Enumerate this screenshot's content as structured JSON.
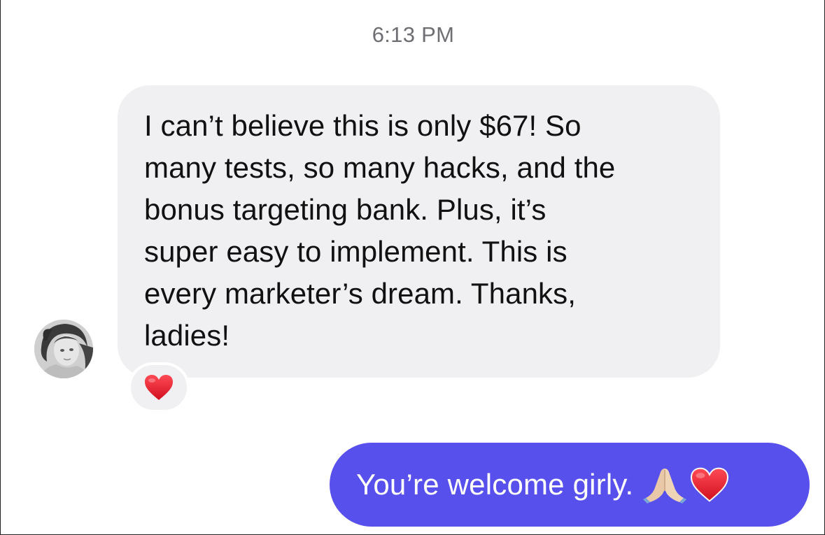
{
  "conversation": {
    "timestamp": "6:13 PM",
    "incoming": {
      "text": "I can’t believe this is only $67! So\nmany tests, so many hacks, and the\nbonus targeting bank. Plus, it’s\nsuper easy to implement. This is\nevery marketer’s dream. Thanks,\nladies!",
      "reaction_icon": "red-heart-icon",
      "avatar_icon": "avatar-photo"
    },
    "outgoing": {
      "text": "You’re welcome girly.",
      "emoji_icons": [
        "folded-hands-icon",
        "red-heart-icon"
      ]
    }
  },
  "colors": {
    "incoming_bubble": "#f0f0f2",
    "outgoing_bubble": "#5850ec",
    "timestamp": "#6e6e73",
    "heart": "#e11d2a"
  }
}
